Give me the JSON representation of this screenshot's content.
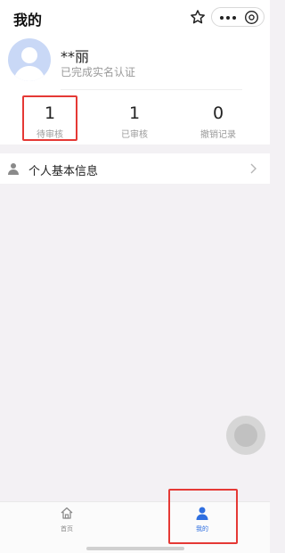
{
  "header": {
    "title": "我的"
  },
  "profile": {
    "name": "**丽",
    "verify_status": "已完成实名认证"
  },
  "stats": [
    {
      "value": "1",
      "label": "待审核"
    },
    {
      "value": "1",
      "label": "已审核"
    },
    {
      "value": "0",
      "label": "撤销记录"
    }
  ],
  "menu": {
    "personal_info_label": "个人基本信息"
  },
  "tabbar": {
    "items": [
      {
        "label": "首页",
        "icon": "home-icon",
        "active": false
      },
      {
        "label": "我的",
        "icon": "person-icon",
        "active": true
      }
    ]
  },
  "colors": {
    "accent": "#2f6fe0",
    "highlight": "#e53935",
    "avatar_bg": "#c9d8f6"
  }
}
